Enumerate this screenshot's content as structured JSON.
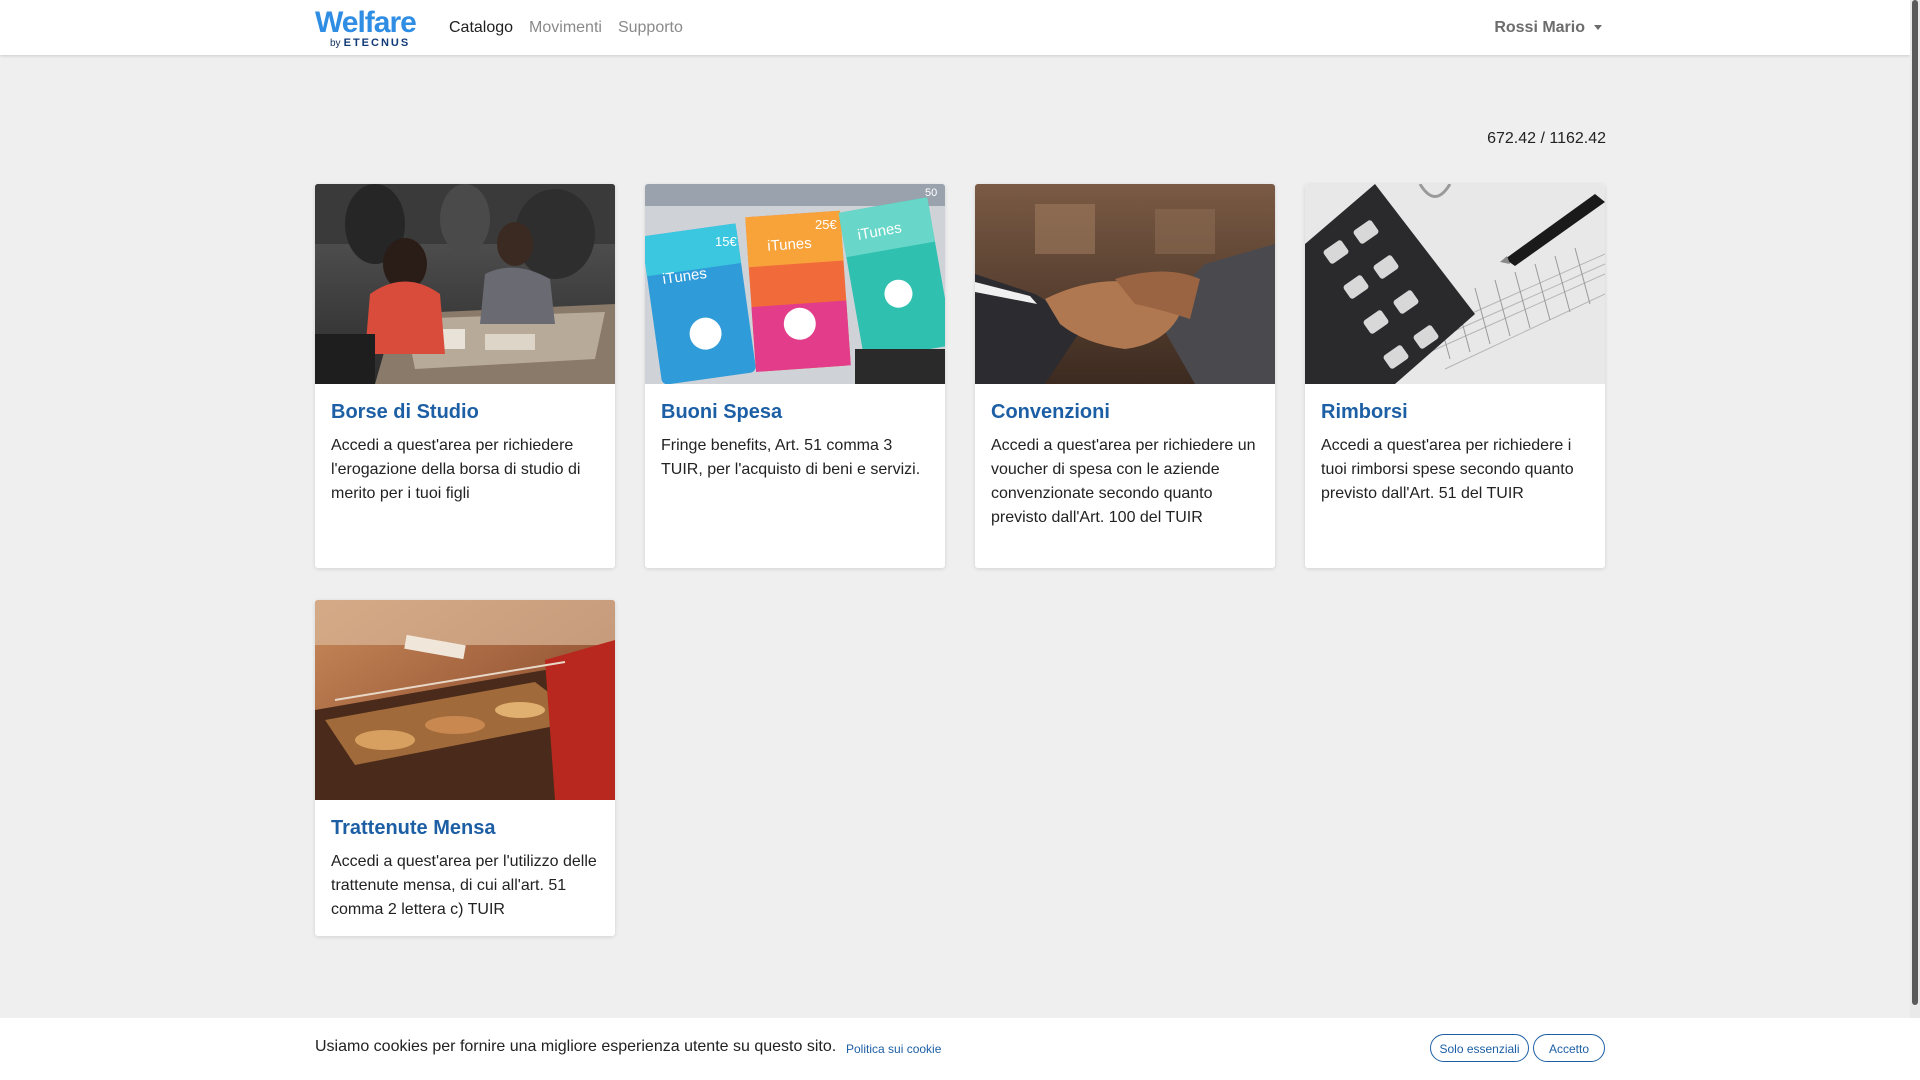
{
  "brand": {
    "main": "Welfare",
    "by": "by",
    "company": "ETECNUS"
  },
  "nav": {
    "items": [
      "Catalogo",
      "Movimenti",
      "Supporto"
    ],
    "active": "Catalogo"
  },
  "user": {
    "name": "Rossi Mario"
  },
  "balance": "672.42 / 1162.42",
  "cards": [
    {
      "title": "Borse di Studio",
      "text": "Accedi a quest'area per richiedere l'erogazione della borsa di studio di merito per i tuoi figli"
    },
    {
      "title": "Buoni Spesa",
      "text": "Fringe benefits, Art. 51 comma 3 TUIR, per l'acquisto di beni e servizi."
    },
    {
      "title": "Convenzioni",
      "text": "Accedi a quest'area per richiedere un voucher di spesa con le aziende convenzionate secondo quanto previsto dall'Art. 100 del TUIR"
    },
    {
      "title": "Rimborsi",
      "text": "Accedi a quest'area per richiedere i tuoi rimborsi spese secondo quanto previsto dall'Art. 51 del TUIR"
    },
    {
      "title": "Trattenute Mensa",
      "text": "Accedi a quest'area per l'utilizzo delle trattenute mensa, di cui all'art. 51 comma 2 lettera c) TUIR"
    }
  ],
  "gift_cards": {
    "brand": "iTunes",
    "price_a": "15€",
    "price_b": "25€",
    "price_c": "50"
  },
  "cookie": {
    "text": "Usiamo cookies per fornire una migliore esperienza utente su questo sito.",
    "link": "Politica sui cookie",
    "essential_btn": "Solo essenziali",
    "accept_btn": "Accetto"
  }
}
